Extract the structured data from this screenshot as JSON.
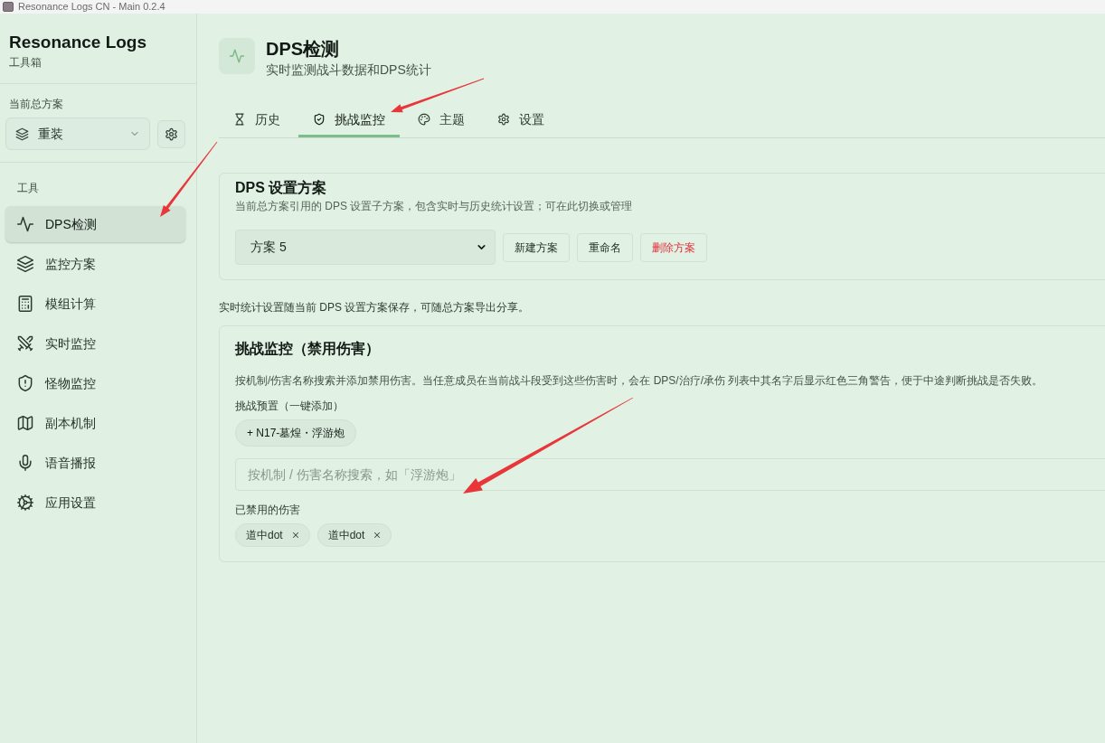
{
  "window": {
    "title": "Resonance Logs CN - Main 0.2.4"
  },
  "sidebar": {
    "app_name": "Resonance Logs",
    "app_subtitle": "工具箱",
    "profile_label": "当前总方案",
    "profile_select": {
      "value": "重装"
    },
    "section_label": "工具",
    "items": [
      {
        "label": "DPS检测",
        "selected": true
      },
      {
        "label": "监控方案",
        "selected": false
      },
      {
        "label": "模组计算",
        "selected": false
      },
      {
        "label": "实时监控",
        "selected": false
      },
      {
        "label": "怪物监控",
        "selected": false
      },
      {
        "label": "副本机制",
        "selected": false
      },
      {
        "label": "语音播报",
        "selected": false
      },
      {
        "label": "应用设置",
        "selected": false
      }
    ]
  },
  "header": {
    "title": "DPS检测",
    "subtitle": "实时监测战斗数据和DPS统计"
  },
  "tabs": [
    {
      "label": "历史",
      "selected": false
    },
    {
      "label": "挑战监控",
      "selected": true
    },
    {
      "label": "主题",
      "selected": false
    },
    {
      "label": "设置",
      "selected": false
    }
  ],
  "dps_profile_card": {
    "title": "DPS 设置方案",
    "description": "当前总方案引用的 DPS 设置子方案，包含实时与历史统计设置；可在此切换或管理",
    "select": {
      "value": "方案 5"
    },
    "buttons": [
      {
        "label": "新建方案",
        "kind": "normal"
      },
      {
        "label": "重命名",
        "kind": "normal"
      },
      {
        "label": "删除方案",
        "kind": "danger"
      }
    ]
  },
  "note": "实时统计设置随当前 DPS 设置方案保存，可随总方案导出分享。",
  "challenge_card": {
    "title": "挑战监控（禁用伤害）",
    "description": "按机制/伤害名称搜索并添加禁用伤害。当任意成员在当前战斗段受到这些伤害时，会在 DPS/治疗/承伤 列表中其名字后显示红色三角警告，便于中途判断挑战是否失败。",
    "presets_label": "挑战预置（一键添加）",
    "presets": [
      "+ N17-墓煌・浮游炮"
    ],
    "search": {
      "placeholder": "按机制 / 伤害名称搜索，如「浮游炮」"
    },
    "banned_label": "已禁用的伤害",
    "banned": [
      "道中dot",
      "道中dot"
    ]
  }
}
